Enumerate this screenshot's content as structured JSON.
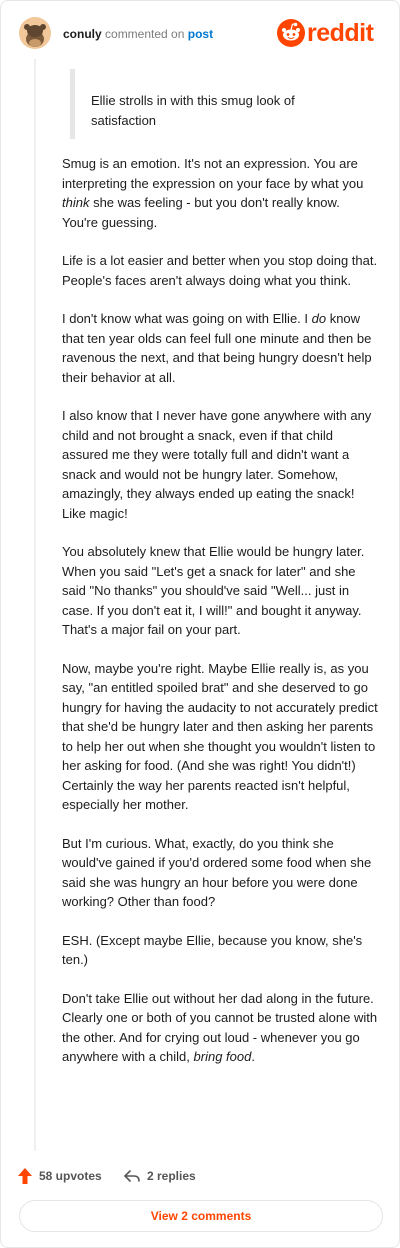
{
  "header": {
    "username": "conuly",
    "action_text": "commented on",
    "post_link": "post",
    "logo_text": "reddit"
  },
  "quote": {
    "text": "Ellie strolls in with this smug look of satisfaction"
  },
  "comment": {
    "p1_a": "Smug is an emotion. It's not an expression. You are interpreting the expression on your face by what you ",
    "p1_em": "think",
    "p1_b": " she was feeling - but you don't really know. You're guessing.",
    "p2": "Life is a lot easier and better when you stop doing that. People's faces aren't always doing what you think.",
    "p3_a": "I don't know what was going on with Ellie. I ",
    "p3_em": "do",
    "p3_b": " know that ten year olds can feel full one minute and then be ravenous the next, and that being hungry doesn't help their behavior at all.",
    "p4": "I also know that I never have gone anywhere with any child and not brought a snack, even if that child assured me they were totally full and didn't want a snack and would not be hungry later. Somehow, amazingly, they always ended up eating the snack! Like magic!",
    "p5": "You absolutely knew that Ellie would be hungry later. When you said \"Let's get a snack for later\" and she said \"No thanks\" you should've said \"Well... just in case. If you don't eat it, I will!\" and bought it anyway. That's a major fail on your part.",
    "p6": "Now, maybe you're right. Maybe Ellie really is, as you say, \"an entitled spoiled brat\" and she deserved to go hungry for having the audacity to not accurately predict that she'd be hungry later and then asking her parents to help her out when she thought you wouldn't listen to her asking for food. (And she was right! You didn't!) Certainly the way her parents reacted isn't helpful, especially her mother.",
    "p7": "But I'm curious. What, exactly, do you think she would've gained if you'd ordered some food when she said she was hungry an hour before you were done working? Other than food?",
    "p8": "ESH. (Except maybe Ellie, because you know, she's ten.)",
    "p9_a": "Don't take Ellie out without her dad along in the future. Clearly one or both of you cannot be trusted alone with the other. And for crying out loud - whenever you go anywhere with a child, ",
    "p9_em": "bring food",
    "p9_b": "."
  },
  "footer": {
    "upvotes": "58 upvotes",
    "replies": "2 replies",
    "view_comments": "View 2 comments"
  },
  "colors": {
    "brand": "#ff4500",
    "link": "#0079d3"
  },
  "icons": {
    "avatar": "snoo-avatar",
    "logo": "reddit-logo-icon",
    "upvote": "upvote-arrow-icon",
    "reply": "reply-arrow-icon"
  }
}
